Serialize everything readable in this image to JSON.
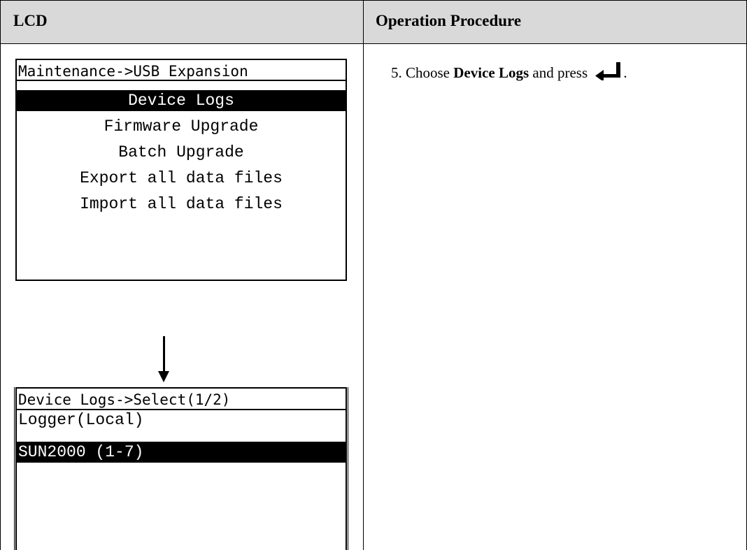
{
  "table": {
    "headers": {
      "lcd": "LCD",
      "procedure": "Operation Procedure"
    }
  },
  "screen1": {
    "title": "Maintenance->USB Expansion",
    "items": [
      {
        "label": "Device Logs",
        "selected": true
      },
      {
        "label": "Firmware Upgrade",
        "selected": false
      },
      {
        "label": "Batch Upgrade",
        "selected": false
      },
      {
        "label": "Export all data files",
        "selected": false
      },
      {
        "label": "Import all data files",
        "selected": false
      }
    ]
  },
  "screen2": {
    "title": "Device Logs->Select(1/2)",
    "items": [
      {
        "label": "Logger(Local)",
        "selected": false
      },
      {
        "label": "SUN2000 (1-7)",
        "selected": true
      }
    ]
  },
  "procedure": {
    "step_prefix": "5. Choose ",
    "step_bold": "Device Logs",
    "step_suffix": " and press ",
    "step_end": ".",
    "key_icon": "enter-key-icon"
  }
}
